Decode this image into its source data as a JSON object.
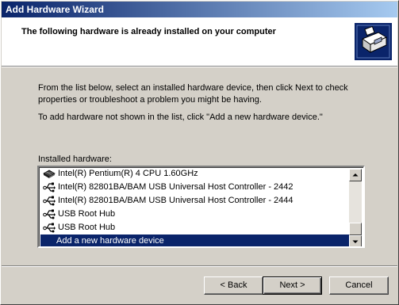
{
  "window": {
    "title": "Add Hardware Wizard"
  },
  "header": {
    "title": "The following hardware is already installed on your computer",
    "icon": "hardware-wizard-icon"
  },
  "body": {
    "instruction1": "From the list below, select an installed hardware device, then click Next to check properties or troubleshoot a problem you might be having.",
    "instruction2": "To add hardware not shown in the list, click \"Add a new hardware device.\"",
    "list_label": "Installed hardware:"
  },
  "hardware_list": {
    "items": [
      {
        "label": "Intel(R) Pentium(R) 4 CPU 1.60GHz",
        "icon": "cpu-icon"
      },
      {
        "label": "Intel(R) 82801BA/BAM USB Universal Host Controller - 2442",
        "icon": "usb-icon"
      },
      {
        "label": "Intel(R) 82801BA/BAM USB Universal Host Controller - 2444",
        "icon": "usb-icon"
      },
      {
        "label": "USB Root Hub",
        "icon": "usb-icon"
      },
      {
        "label": "USB Root Hub",
        "icon": "usb-icon"
      },
      {
        "label": "Add a new hardware device",
        "icon": "",
        "selected": true
      }
    ]
  },
  "buttons": {
    "back": "< Back",
    "next": "Next >",
    "cancel": "Cancel"
  },
  "colors": {
    "selection": "#0a246a",
    "title_gradient_start": "#0a246a",
    "title_gradient_end": "#a6caf0"
  }
}
